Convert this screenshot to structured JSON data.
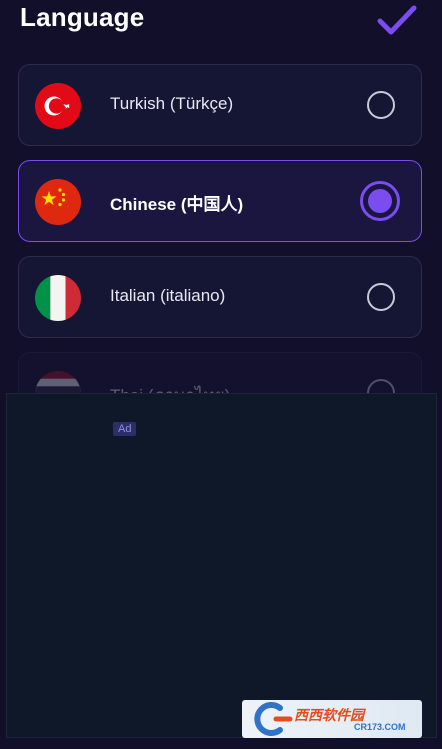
{
  "header": {
    "title": "Language",
    "confirm_icon": "checkmark-icon"
  },
  "languages": [
    {
      "label": "Turkish (Türkçe)",
      "flag": "turkey-flag-icon",
      "selected": false
    },
    {
      "label": "Chinese (中国人)",
      "flag": "china-flag-icon",
      "selected": true
    },
    {
      "label": "Italian (italiano)",
      "flag": "italy-flag-icon",
      "selected": false
    },
    {
      "label": "Thai (ภาษาไทย)",
      "flag": "thailand-flag-icon",
      "selected": false
    }
  ],
  "ad": {
    "badge": "Ad"
  },
  "watermark": {
    "text": "西西软件园",
    "sub": "CR173.COM"
  },
  "colors": {
    "background": "#120f2b",
    "accent": "#7b4cf0",
    "card": "#151634",
    "ad_background": "#0f1829"
  }
}
